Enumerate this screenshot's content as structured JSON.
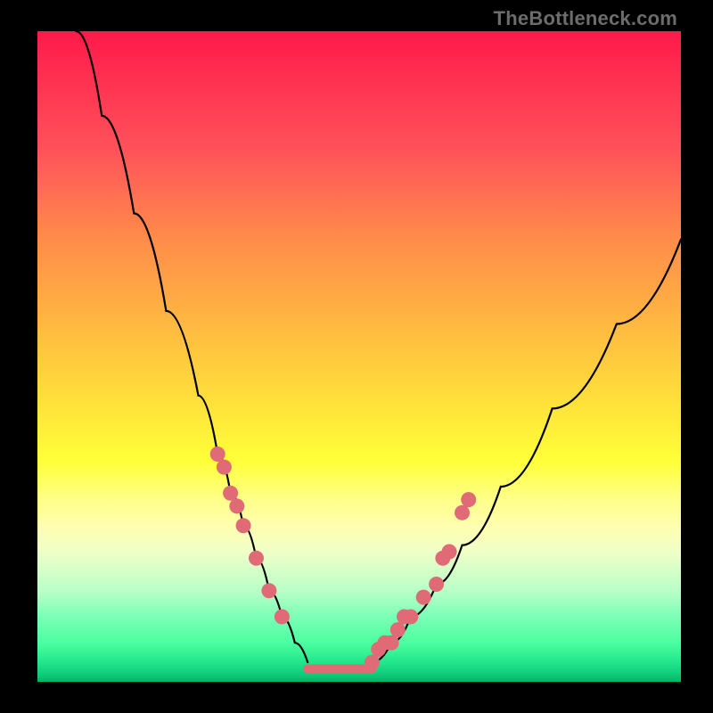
{
  "watermark": "TheBottleneck.com",
  "colors": {
    "background": "#000000",
    "watermark": "#6c6c6c",
    "curve": "#000000",
    "marker": "#e06a76"
  },
  "chart_data": {
    "type": "line",
    "title": "",
    "xlabel": "",
    "ylabel": "",
    "xlim": [
      0,
      100
    ],
    "ylim": [
      0,
      100
    ],
    "series": [
      {
        "name": "left-curve",
        "x": [
          6,
          10,
          15,
          20,
          25,
          28,
          30,
          32,
          34,
          36,
          38,
          40,
          42
        ],
        "values": [
          100,
          87,
          72,
          57,
          44,
          35,
          29,
          24,
          19,
          14,
          10,
          6,
          3
        ]
      },
      {
        "name": "right-curve",
        "x": [
          52,
          55,
          58,
          62,
          66,
          72,
          80,
          90,
          100
        ],
        "values": [
          3,
          6,
          10,
          15,
          21,
          30,
          42,
          55,
          68
        ]
      }
    ],
    "flat_segment": {
      "x_start": 42,
      "x_end": 52,
      "y": 2
    },
    "markers": {
      "left": [
        [
          28,
          35
        ],
        [
          29,
          33
        ],
        [
          30,
          29
        ],
        [
          31,
          27
        ],
        [
          32,
          24
        ],
        [
          34,
          19
        ],
        [
          36,
          14
        ],
        [
          38,
          10
        ]
      ],
      "right": [
        [
          52,
          3
        ],
        [
          53,
          5
        ],
        [
          54,
          6
        ],
        [
          55,
          6
        ],
        [
          56,
          8
        ],
        [
          57,
          10
        ],
        [
          58,
          10
        ],
        [
          60,
          13
        ],
        [
          62,
          15
        ],
        [
          63,
          19
        ],
        [
          64,
          20
        ],
        [
          66,
          26
        ],
        [
          67,
          28
        ]
      ]
    },
    "gradient_stops": [
      {
        "pos": 0,
        "color": "#ff1a4a"
      },
      {
        "pos": 18,
        "color": "#ff515a"
      },
      {
        "pos": 32,
        "color": "#ff8c4a"
      },
      {
        "pos": 48,
        "color": "#ffc23f"
      },
      {
        "pos": 58,
        "color": "#ffe43a"
      },
      {
        "pos": 66,
        "color": "#ffff38"
      },
      {
        "pos": 72,
        "color": "#ffff8a"
      },
      {
        "pos": 76,
        "color": "#ffffaf"
      },
      {
        "pos": 80,
        "color": "#f0ffc8"
      },
      {
        "pos": 86,
        "color": "#b9ffc8"
      },
      {
        "pos": 90,
        "color": "#7bffb6"
      },
      {
        "pos": 94,
        "color": "#4bffa0"
      },
      {
        "pos": 97,
        "color": "#22e68c"
      },
      {
        "pos": 99,
        "color": "#0fc979"
      },
      {
        "pos": 100,
        "color": "#00b463"
      }
    ]
  }
}
